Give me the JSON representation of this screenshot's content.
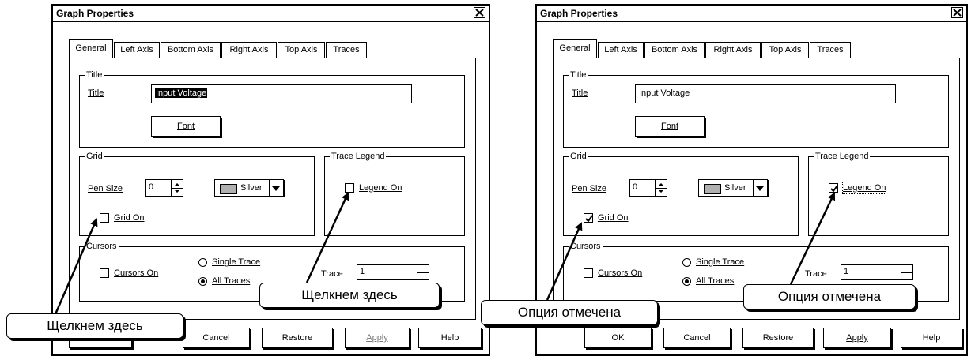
{
  "dialog_title": "Graph Properties",
  "tabs": [
    "General",
    "Left Axis",
    "Bottom Axis",
    "Right Axis",
    "Top Axis",
    "Traces"
  ],
  "title_group": {
    "label": "Title",
    "field_label": "Title",
    "value": "Input Voltage",
    "font_button": "Font"
  },
  "grid_group": {
    "label": "Grid",
    "pen_size_label": "Pen Size",
    "pen_size": "0",
    "color": "Silver",
    "grid_on_label": "Grid On"
  },
  "legend_group": {
    "label": "Trace Legend",
    "legend_on_label": "Legend On"
  },
  "cursors_group": {
    "label": "Cursors",
    "cursors_on_label": "Cursors On",
    "single_trace": "Single Trace",
    "all_traces": "All Traces",
    "trace_label": "Trace",
    "trace_value": "1"
  },
  "buttons": {
    "ok": "OK",
    "cancel": "Cancel",
    "restore": "Restore",
    "apply": "Apply",
    "help": "Help"
  },
  "left_state": {
    "grid_on": false,
    "legend_on": false,
    "all_traces_selected": true
  },
  "right_state": {
    "grid_on": true,
    "legend_on": true,
    "all_traces_selected": true
  },
  "callouts": {
    "left_bottom": "Щелкнем здесь",
    "left_mid": "Щелкнем здесь",
    "right_bottom": "Опция отмечена",
    "right_mid": "Опция отмечена"
  }
}
